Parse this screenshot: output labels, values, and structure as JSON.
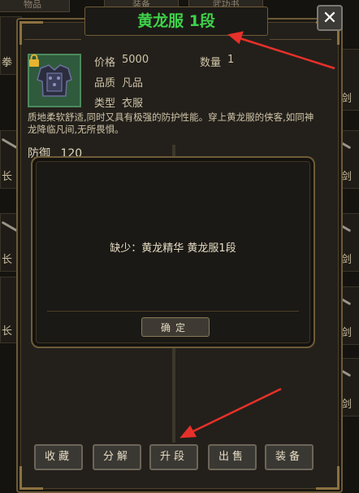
{
  "background": {
    "tabs": [
      "物品",
      "装备",
      "武功书"
    ],
    "left_cells": [
      "拳",
      "长",
      "长",
      "长",
      "长"
    ],
    "right_cells": [
      "长剑",
      "长剑",
      "长剑",
      "长剑",
      "长剑"
    ]
  },
  "item": {
    "title": "黄龙服 1段",
    "price_label": "价格",
    "price_value": "5000",
    "quantity_label": "数量",
    "quantity_value": "1",
    "quality_label": "品质",
    "quality_value": "凡品",
    "type_label": "类型",
    "type_value": "衣服",
    "description": "质地柔软舒适,同时又具有极强的防护性能。穿上黄龙服的侠客,如同神龙降临凡间,无所畏惧。",
    "defense_label": "防御",
    "defense_value": "120"
  },
  "close": {
    "label": "✕"
  },
  "modal": {
    "message": "缺少：黄龙精华 黄龙服1段",
    "confirm_label": "确定"
  },
  "actions": [
    {
      "label": "收藏"
    },
    {
      "label": "分解"
    },
    {
      "label": "升段"
    },
    {
      "label": "出售"
    },
    {
      "label": "装备"
    }
  ],
  "colors": {
    "title_green": "#3fd14a",
    "frame_gold": "#8c7140",
    "annotation_red": "#e8302a"
  }
}
